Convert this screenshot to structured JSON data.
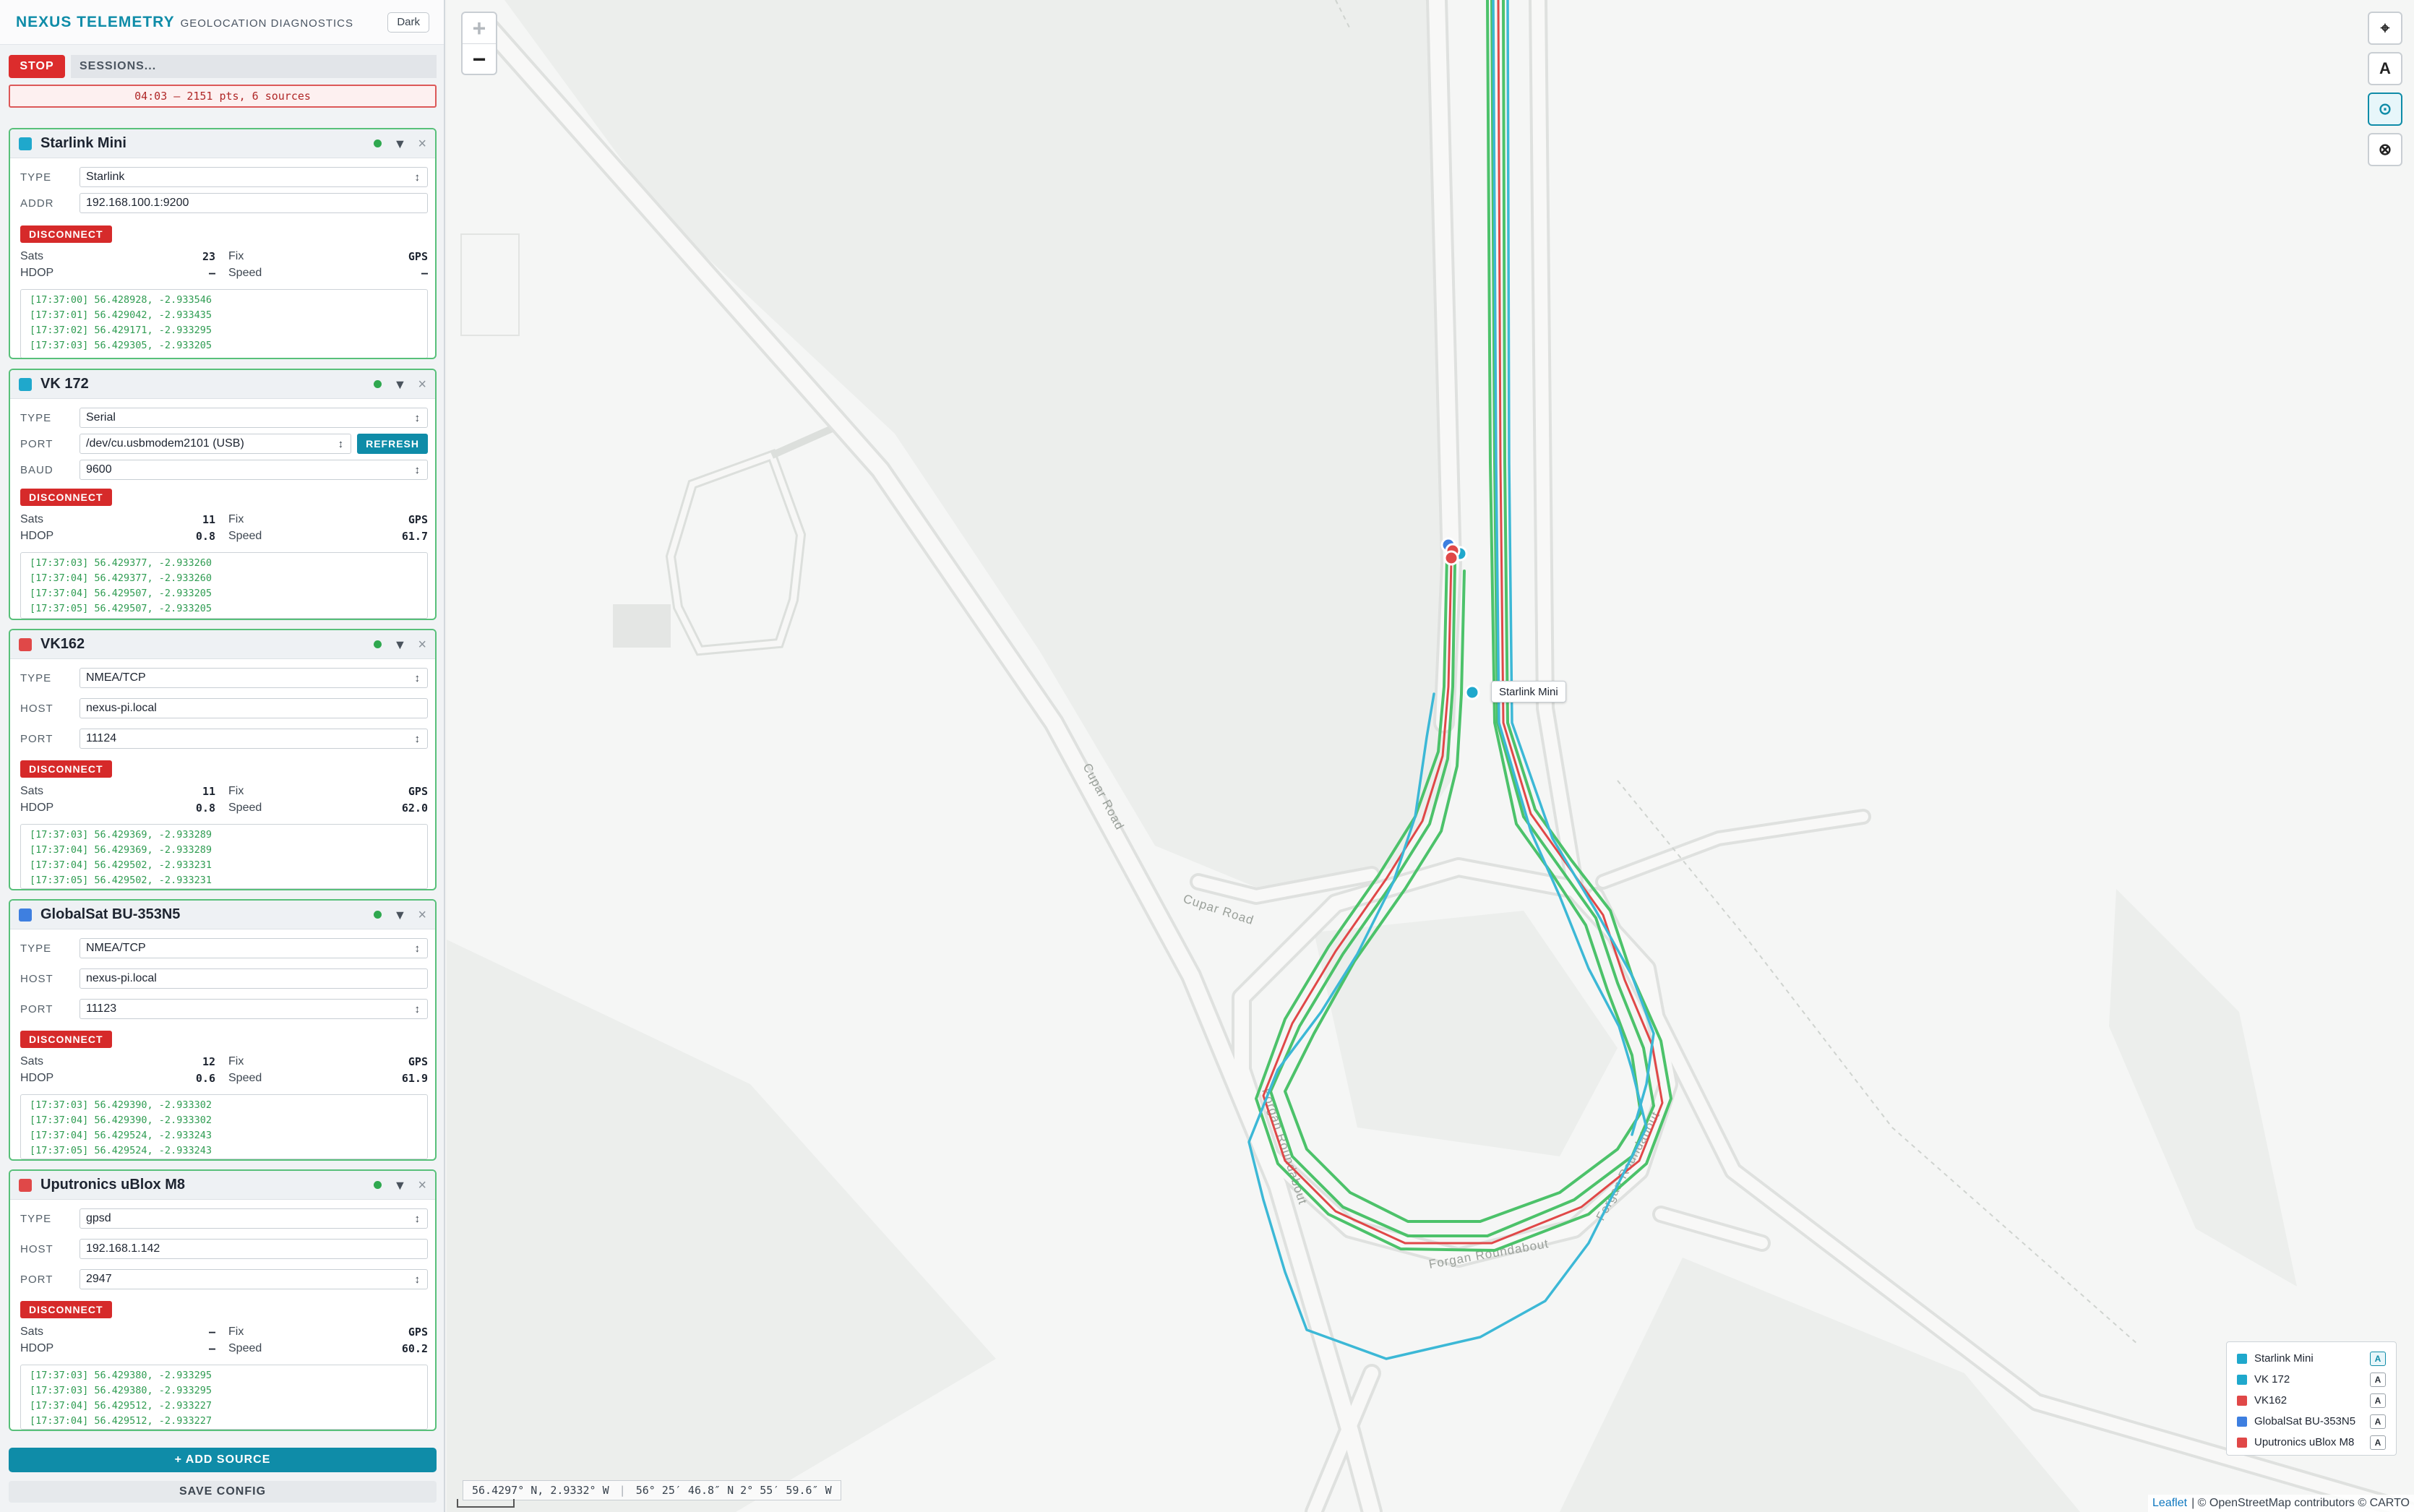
{
  "header": {
    "brand": "NEXUS TELEMETRY",
    "subtitle": "GEOLOCATION DIAGNOSTICS",
    "theme_button": "Dark"
  },
  "controls": {
    "stop_label": "STOP",
    "sessions_label": "SESSIONS...",
    "status_text": "04:03 — 2151 pts, 6 sources"
  },
  "field_labels": {
    "type": "TYPE",
    "addr": "ADDR",
    "port": "PORT",
    "baud": "BAUD",
    "host": "HOST",
    "disconnect": "DISCONNECT",
    "refresh": "REFRESH",
    "sats": "Sats",
    "hdop": "HDOP",
    "fix": "Fix",
    "speed": "Speed"
  },
  "sources": [
    {
      "name": "Starlink Mini",
      "color": "#1fa8cc",
      "fields": [
        {
          "label": "TYPE",
          "value": "Starlink",
          "kind": "select"
        },
        {
          "label": "ADDR",
          "value": "192.168.100.1:9200",
          "kind": "input"
        }
      ],
      "stats": {
        "sats": "23",
        "hdop": "—",
        "fix": "GPS",
        "speed": "—"
      },
      "log": [
        "[17:37:00] 56.428928, -2.933546",
        "[17:37:01] 56.429042, -2.933435",
        "[17:37:02] 56.429171, -2.933295",
        "[17:37:03] 56.429305, -2.933205"
      ]
    },
    {
      "name": "VK 172",
      "color": "#1fa8cc",
      "fields": [
        {
          "label": "TYPE",
          "value": "Serial",
          "kind": "select"
        },
        {
          "label": "PORT",
          "value": "/dev/cu.usbmodem2101 (USB)",
          "kind": "select"
        },
        {
          "label": "BAUD",
          "value": "9600",
          "kind": "select"
        }
      ],
      "stats": {
        "sats": "11",
        "hdop": "0.8",
        "fix": "GPS",
        "speed": "61.7"
      },
      "log": [
        "[17:37:03] 56.429377, -2.933260",
        "[17:37:04] 56.429377, -2.933260",
        "[17:37:04] 56.429507, -2.933205",
        "[17:37:05] 56.429507, -2.933205"
      ]
    },
    {
      "name": "VK162",
      "color": "#e04848",
      "fields": [
        {
          "label": "TYPE",
          "value": "NMEA/TCP",
          "kind": "select"
        },
        {
          "label": "HOST",
          "value": "nexus-pi.local",
          "kind": "input"
        },
        {
          "label": "PORT",
          "value": "11124",
          "kind": "select"
        }
      ],
      "stats": {
        "sats": "11",
        "hdop": "0.8",
        "fix": "GPS",
        "speed": "62.0"
      },
      "log": [
        "[17:37:03] 56.429369, -2.933289",
        "[17:37:04] 56.429369, -2.933289",
        "[17:37:04] 56.429502, -2.933231",
        "[17:37:05] 56.429502, -2.933231"
      ]
    },
    {
      "name": "GlobalSat BU-353N5",
      "color": "#3e7fe0",
      "fields": [
        {
          "label": "TYPE",
          "value": "NMEA/TCP",
          "kind": "select"
        },
        {
          "label": "HOST",
          "value": "nexus-pi.local",
          "kind": "input"
        },
        {
          "label": "PORT",
          "value": "11123",
          "kind": "select"
        }
      ],
      "stats": {
        "sats": "12",
        "hdop": "0.6",
        "fix": "GPS",
        "speed": "61.9"
      },
      "log": [
        "[17:37:03] 56.429390, -2.933302",
        "[17:37:04] 56.429390, -2.933302",
        "[17:37:04] 56.429524, -2.933243",
        "[17:37:05] 56.429524, -2.933243"
      ]
    },
    {
      "name": "Uputronics uBlox M8",
      "color": "#e04848",
      "fields": [
        {
          "label": "TYPE",
          "value": "gpsd",
          "kind": "select"
        },
        {
          "label": "HOST",
          "value": "192.168.1.142",
          "kind": "input"
        },
        {
          "label": "PORT",
          "value": "2947",
          "kind": "select"
        }
      ],
      "stats": {
        "sats": "—",
        "hdop": "—",
        "fix": "GPS",
        "speed": "60.2"
      },
      "log": [
        "[17:37:03] 56.429380, -2.933295",
        "[17:37:03] 56.429380, -2.933295",
        "[17:37:04] 56.429512, -2.933227",
        "[17:37:04] 56.429512, -2.933227"
      ]
    }
  ],
  "footer": {
    "add_source": "+ ADD SOURCE",
    "save_config": "SAVE CONFIG"
  },
  "map": {
    "zoom_in": "+",
    "zoom_out": "−",
    "coords_decimal": "56.4297° N, 2.9332° W",
    "coords_dms": "56° 25′ 46.8″ N 2° 55′ 59.6″ W",
    "road_labels": [
      "Cupar Road",
      "Cupar Road",
      "Forgan Roundabout",
      "Forgan Roundabout",
      "Forgan Roundabout"
    ],
    "tooltip": "Starlink Mini",
    "attribution_leaflet": "Leaflet",
    "attribution_rest": "| © OpenStreetMap contributors © CARTO",
    "legend": [
      {
        "name": "Starlink Mini",
        "color": "#1fa8cc",
        "active": true
      },
      {
        "name": "VK 172",
        "color": "#1fa8cc",
        "active": false
      },
      {
        "name": "VK162",
        "color": "#e04848",
        "active": false
      },
      {
        "name": "GlobalSat BU-353N5",
        "color": "#3e7fe0",
        "active": false
      },
      {
        "name": "Uputronics uBlox M8",
        "color": "#e04848",
        "active": false
      }
    ],
    "legend_toggle": "A",
    "right_controls": [
      "locate-icon",
      "auto-label",
      "center-icon",
      "clear-icon"
    ],
    "track_colors": {
      "green": "#4cc26a",
      "cyan": "#3cb8d6",
      "red": "#e04848",
      "blue": "#3e7fe0"
    }
  }
}
